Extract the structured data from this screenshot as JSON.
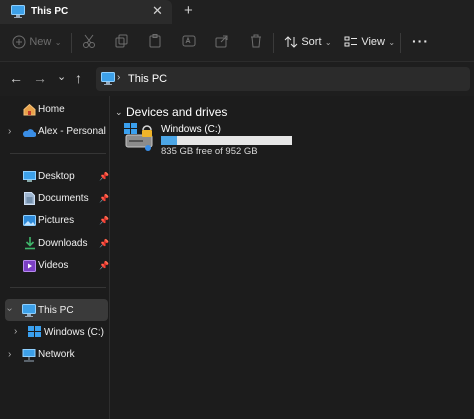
{
  "window": {
    "tab_title": "This PC"
  },
  "toolbar": {
    "new_label": "New",
    "sort_label": "Sort",
    "view_label": "View"
  },
  "address": {
    "path": "This PC"
  },
  "sidebar": {
    "home": "Home",
    "onedrive": "Alex - Personal",
    "quick": [
      "Desktop",
      "Documents",
      "Pictures",
      "Downloads",
      "Videos"
    ],
    "this_pc": "This PC",
    "windows_c": "Windows (C:)",
    "network": "Network"
  },
  "main": {
    "section_title": "Devices and drives",
    "drive": {
      "name": "Windows (C:)",
      "info": "835 GB free of 952 GB",
      "used_fraction": 0.123
    }
  },
  "colors": {
    "accent": "#4ca6e6",
    "background": "#1c1c1c"
  }
}
